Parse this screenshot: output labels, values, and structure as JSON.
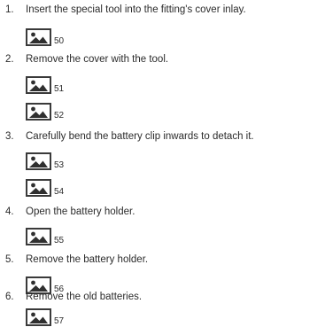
{
  "steps": [
    {
      "number": "1.",
      "text": "Insert the special tool into the fitting's cover inlay.",
      "figures": [
        "50"
      ]
    },
    {
      "number": "2.",
      "text": "Remove the cover with the tool.",
      "figures": [
        "51",
        "52"
      ]
    },
    {
      "number": "3.",
      "text": "Carefully bend the battery clip inwards to detach it.",
      "figures": [
        "53",
        "54"
      ]
    },
    {
      "number": "4.",
      "text": "Open the battery holder.",
      "figures": [
        "55"
      ]
    },
    {
      "number": "5.",
      "text": "Remove the battery holder.",
      "figures": [
        "56"
      ]
    },
    {
      "number": "6.",
      "text": "Remove the old batteries.",
      "figures": [
        "57"
      ]
    }
  ],
  "icon": "image-placeholder-icon"
}
